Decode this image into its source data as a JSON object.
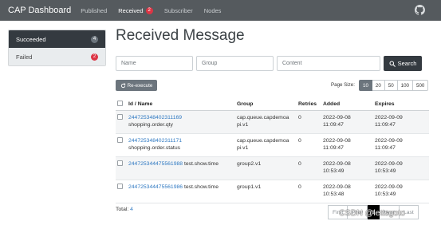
{
  "navbar": {
    "brand": "CAP Dashboard",
    "items": [
      {
        "label": "Published"
      },
      {
        "label": "Received",
        "badge": "2"
      },
      {
        "label": "Subscriber"
      },
      {
        "label": "Nodes"
      }
    ],
    "github_icon": "github-icon"
  },
  "sidebar": {
    "items": [
      {
        "label": "Succeeded",
        "count": "4",
        "badge_color": "#6c757d"
      },
      {
        "label": "Failed",
        "count": "2",
        "badge_color": "#dc3545"
      }
    ]
  },
  "page": {
    "title": "Received Message"
  },
  "search": {
    "name_placeholder": "Name",
    "group_placeholder": "Group",
    "content_placeholder": "Content",
    "button_label": "Search",
    "button_icon": "search-icon"
  },
  "toolbar": {
    "reexecute_label": "Re-execute",
    "reexecute_icon": "refresh-icon",
    "page_size_label": "Page Size:",
    "page_sizes": [
      "10",
      "20",
      "50",
      "100",
      "500"
    ],
    "page_size_selected": "10"
  },
  "table": {
    "headers": [
      "Id / Name",
      "Group",
      "Retries",
      "Added",
      "Expires"
    ],
    "rows": [
      {
        "id": "244725348402311169",
        "name": "shopping.order.qty",
        "group_l1": "cap.queue.capdemoa",
        "group_l2": "pi.v1",
        "retries": "0",
        "added_date": "2022-09-08",
        "added_time": "11:09:47",
        "expires_date": "2022-09-09",
        "expires_time": "11:09:47"
      },
      {
        "id": "244725348402311171",
        "name": "shopping.order.status",
        "group_l1": "cap.queue.capdemoa",
        "group_l2": "pi.v1",
        "retries": "0",
        "added_date": "2022-09-08",
        "added_time": "11:09:47",
        "expires_date": "2022-09-09",
        "expires_time": "11:09:47"
      },
      {
        "id": "244725344475561988",
        "name": "test.show.time",
        "group_l1": "group2.v1",
        "group_l2": "",
        "retries": "0",
        "added_date": "2022-09-08",
        "added_time": "10:53:49",
        "expires_date": "2022-09-09",
        "expires_time": "10:53:49"
      },
      {
        "id": "244725344475561986",
        "name": "test.show.time",
        "group_l1": "group1.v1",
        "group_l2": "",
        "retries": "0",
        "added_date": "2022-09-08",
        "added_time": "10:53:48",
        "expires_date": "2022-09-09",
        "expires_time": "10:53:49"
      }
    ]
  },
  "footer": {
    "total_label": "Total:",
    "total_count": "4",
    "pager": [
      "First",
      "Prev",
      "1",
      "Next",
      "Last"
    ],
    "pager_active": "1"
  },
  "watermark": "CSDN @lettsgoto"
}
